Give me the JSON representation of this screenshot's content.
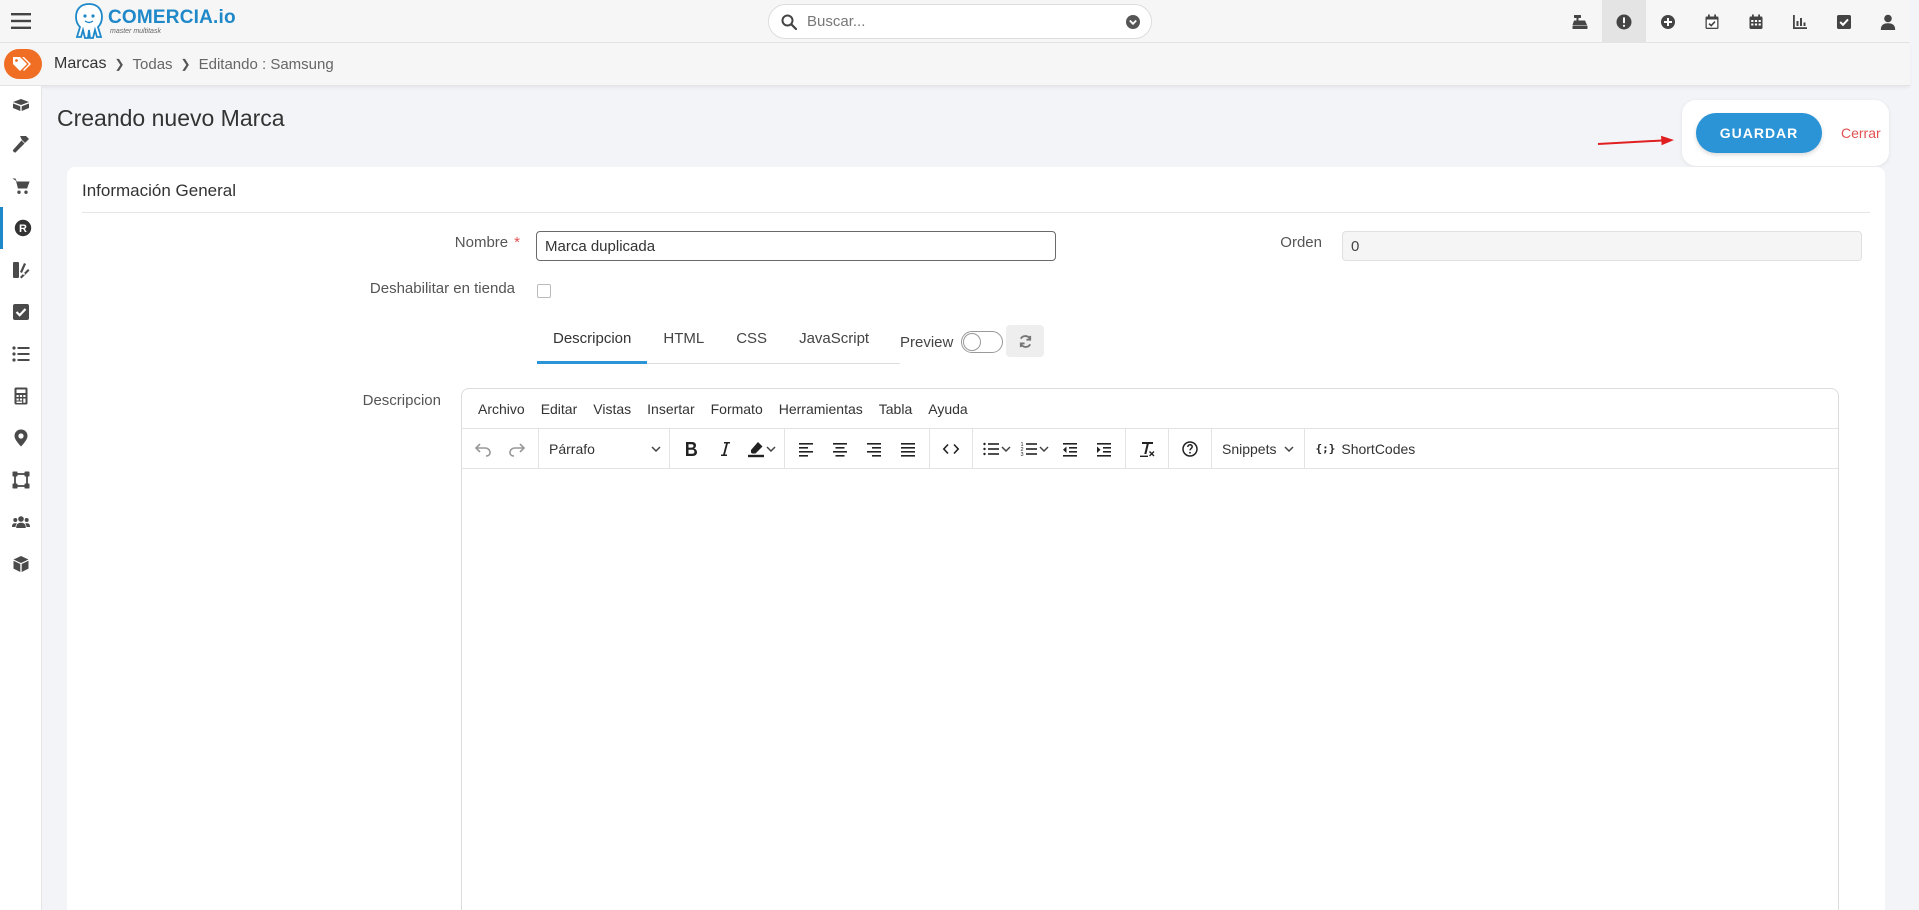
{
  "app": {
    "logo_name": "COMERCIA.io",
    "logo_tagline": "master multitask"
  },
  "search": {
    "placeholder": "Buscar..."
  },
  "breadcrumb": {
    "section": "Marcas",
    "level1": "Todas",
    "level2": "Editando : Samsung"
  },
  "page": {
    "title": "Creando nuevo Marca"
  },
  "actions": {
    "save_label": "GUARDAR",
    "close_label": "Cerrar"
  },
  "card": {
    "title": "Información General"
  },
  "form": {
    "name_label": "Nombre",
    "required_mark": "*",
    "name_value": "Marca duplicada",
    "order_label": "Orden",
    "order_value": "0",
    "disable_label": "Deshabilitar en tienda",
    "disable_checked": false,
    "description_label": "Descripcion"
  },
  "tabs": [
    {
      "label": "Descripcion",
      "active": true
    },
    {
      "label": "HTML",
      "active": false
    },
    {
      "label": "CSS",
      "active": false
    },
    {
      "label": "JavaScript",
      "active": false
    }
  ],
  "preview": {
    "label": "Preview",
    "on": false
  },
  "editor": {
    "menu": [
      "Archivo",
      "Editar",
      "Vistas",
      "Insertar",
      "Formato",
      "Herramientas",
      "Tabla",
      "Ayuda"
    ],
    "block_format": "Párrafo",
    "snippets_label": "Snippets",
    "shortcodes_label": "ShortCodes",
    "shortcodes_icon": "{;}"
  },
  "colors": {
    "accent": "#2a94d6",
    "brand": "#1e88c9",
    "breadcrumb_badge": "#f06d24",
    "close_link": "#e05252",
    "annotation_arrow": "#e02020"
  }
}
